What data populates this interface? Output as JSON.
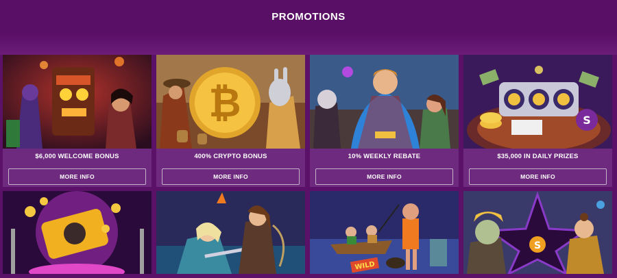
{
  "page": {
    "title": "PROMOTIONS"
  },
  "promotions": [
    {
      "title": "$6,000 WELCOME BONUS",
      "button": "MORE INFO"
    },
    {
      "title": "400% CRYPTO BONUS",
      "button": "MORE INFO"
    },
    {
      "title": "10% WEEKLY REBATE",
      "button": "MORE INFO"
    },
    {
      "title": "$35,000 IN DAILY PRIZES",
      "button": "MORE INFO"
    }
  ],
  "images": {
    "row1": [
      "tiki-totem-characters-art",
      "bitcoin-coin-characters-art",
      "superhero-vampire-art",
      "slot-machine-roulette-art"
    ],
    "row2": [
      "golden-vault-stage-art",
      "fantasy-warriors-art",
      "boat-wild-fishing-art",
      "purple-star-characters-art"
    ]
  },
  "colors": {
    "background": "#5b1168",
    "card": "#6e2a7e",
    "button_border": "#c7b2cc"
  }
}
